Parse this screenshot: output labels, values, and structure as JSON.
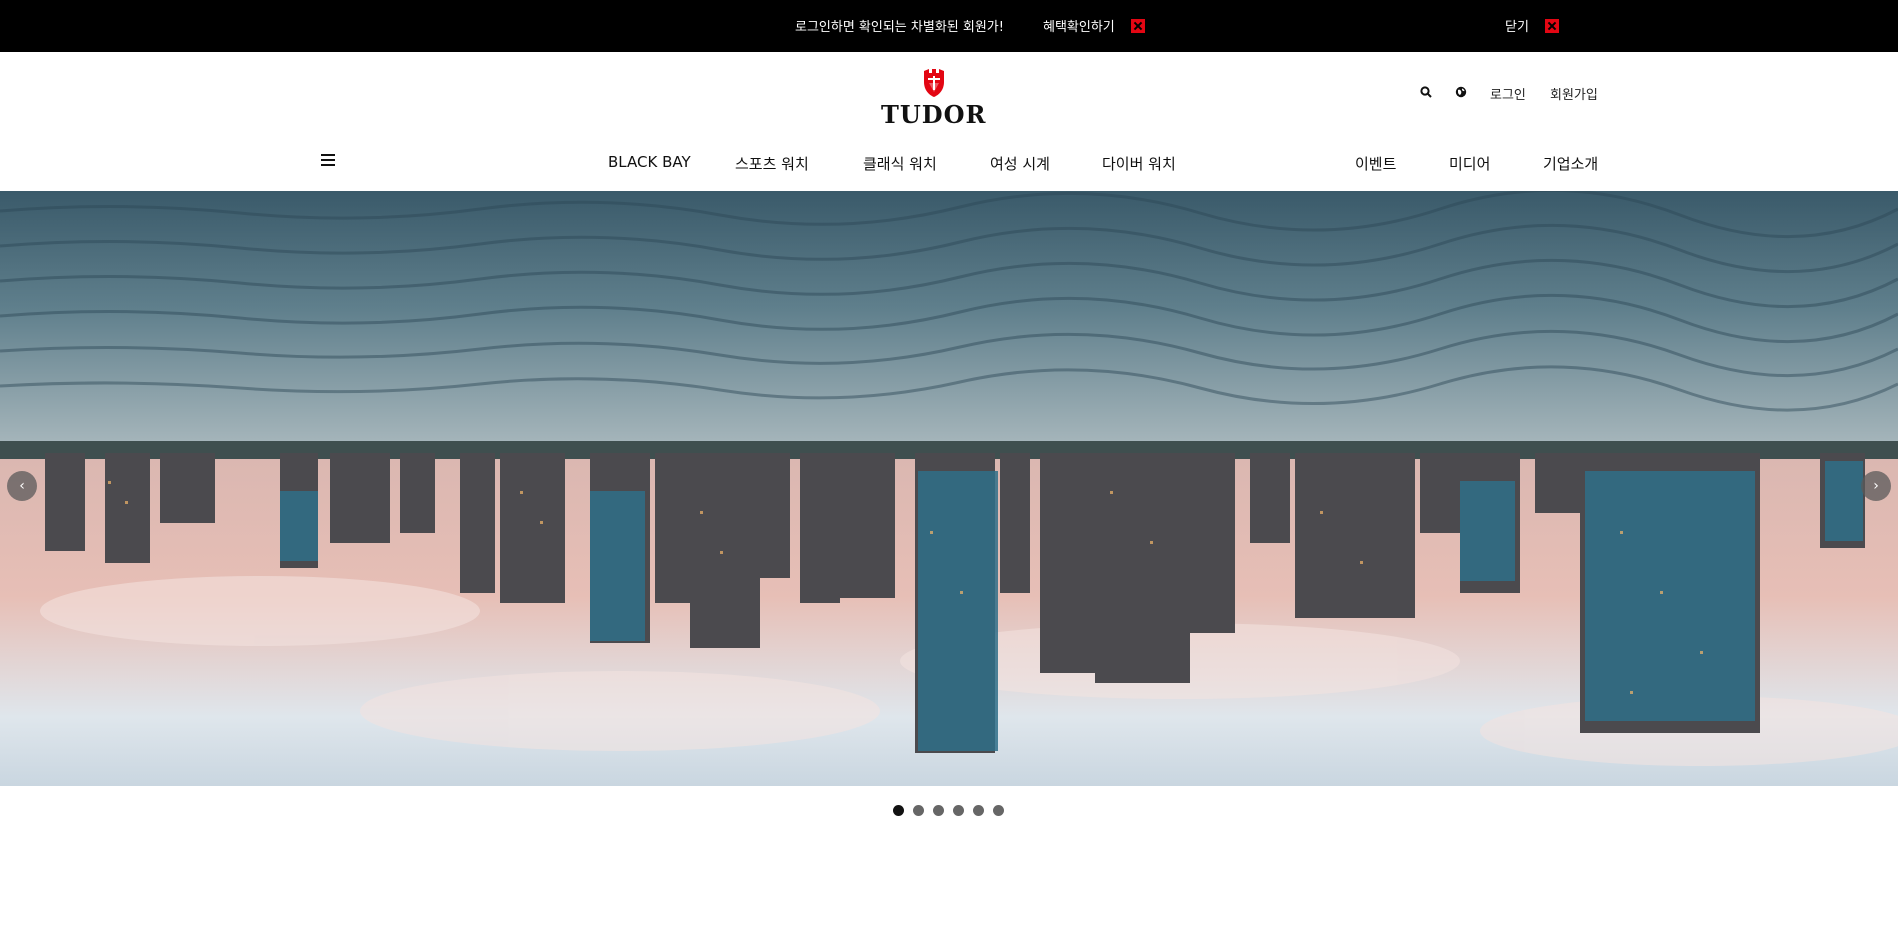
{
  "promo": {
    "message": "로그인하면 확인되는 차별화된 회원가!",
    "check_label": "혜택확인하기",
    "close_label": "닫기",
    "accent_color": "#e30613"
  },
  "header": {
    "logo_text": "TUDOR",
    "util": {
      "search_icon": "search-icon",
      "globe_icon": "globe-icon",
      "login_label": "로그인",
      "join_label": "회원가입"
    },
    "nav_left": [
      "BLACK BAY",
      "스포츠 워치",
      "클래식 워치",
      "여성 시계",
      "다이버 워치"
    ],
    "nav_right": [
      "이벤트",
      "미디어",
      "기업소개"
    ]
  },
  "hero": {
    "prev_arrow": "‹",
    "next_arrow": "›"
  },
  "carousel": {
    "slide_count": 6,
    "active_index": 0
  }
}
